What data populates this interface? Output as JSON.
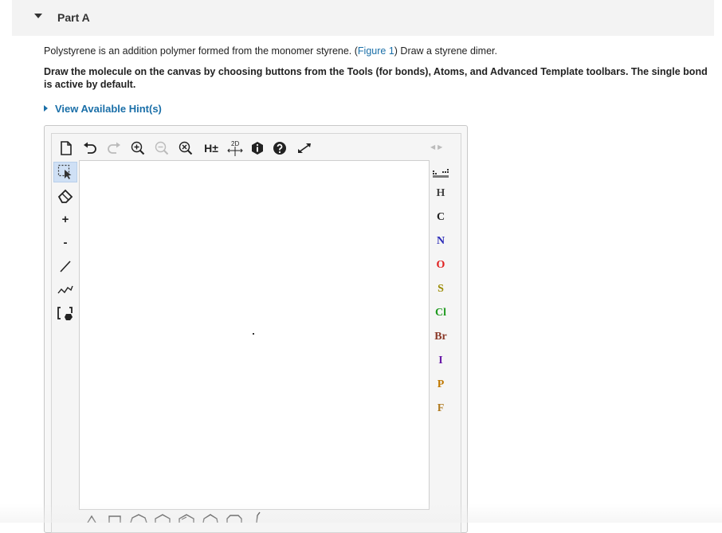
{
  "part": {
    "title": "Part A"
  },
  "question": {
    "text_before": "Polystyrene is an addition polymer formed from the monomer styrene. (",
    "figure_link": "Figure 1",
    "text_after": ") Draw a styrene dimer."
  },
  "instructions": "Draw the molecule on the canvas by choosing buttons from the Tools (for bonds), Atoms, and Advanced Template toolbars. The single bond is active by default.",
  "hints": {
    "label": "View Available Hint(s)"
  },
  "toolbar": {
    "hydrogen_label": "H±",
    "twod_label": "2D"
  },
  "left_tools": {
    "plus_label": "+",
    "minus_label": "-"
  },
  "atoms": [
    {
      "symbol": "H",
      "color": "#444444"
    },
    {
      "symbol": "C",
      "color": "#222222"
    },
    {
      "symbol": "N",
      "color": "#2b2bb8"
    },
    {
      "symbol": "O",
      "color": "#e02020"
    },
    {
      "symbol": "S",
      "color": "#9a8a00"
    },
    {
      "symbol": "Cl",
      "color": "#1f9a1f"
    },
    {
      "symbol": "Br",
      "color": "#8b3a2a"
    },
    {
      "symbol": "I",
      "color": "#6a1aa8"
    },
    {
      "symbol": "P",
      "color": "#c07800"
    },
    {
      "symbol": "F",
      "color": "#b07a20"
    }
  ]
}
